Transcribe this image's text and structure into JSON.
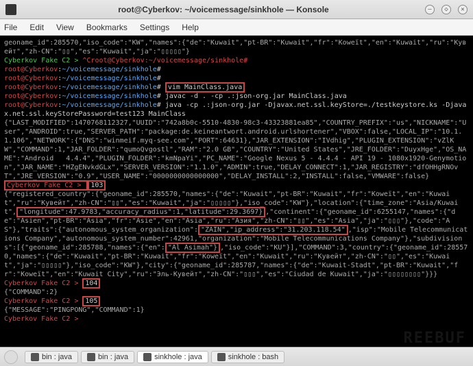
{
  "window": {
    "title": "root@Cyberkov: ~/voicemessage/sinkhole — Konsole",
    "minimize": "–",
    "maximize": "◇",
    "close": "✕"
  },
  "menu": {
    "file": "File",
    "edit": "Edit",
    "view": "View",
    "bookmarks": "Bookmarks",
    "settings": "Settings",
    "help": "Help"
  },
  "tabs": {
    "new": "",
    "t1": "bin : java",
    "t2": "bin : java",
    "t3": "sinkhole : java",
    "t4": "sinkhole : bash"
  },
  "prompt": {
    "user": "root@Cyberkov",
    "path": "~/voicemessage/sinkhole",
    "sep": ":",
    "hash": "#"
  },
  "cmd": {
    "blank": "",
    "vim": "vim MainClass.java",
    "javac": "javac -d . -cp .:json-org.jar MainClass.java",
    "java": "java -cp .:json-org.jar -Djavax.net.ssl.keyStore=./testkeystore.ks -Djavax.net.ssl.keyStorePassword=test123 MainClass"
  },
  "line1": "geoname_id\":285570,\"iso_code\":\"KW\",\"names\":{\"de\":\"Kuwait\",\"pt-BR\":\"Kuwait\",\"fr\":\"Koweït\",\"en\":\"Kuwait\",\"ru\":\"Кувейт\",\"zh-CN\":\"▯▯\",\"es\":\"Kuwait\",\"ja\":\"▯▯▯▯▯\"}",
  "fakec2": "Cyberkov Fake C2 > ",
  "fakec2_cmd": "^Croot@Cyberkov:~/voicemessage/sinkhole#",
  "out1": "{\"LAST_MODIFIED\":1470768112327,\"UUID\":\"742a8b0c-5510-4830-98c3-43323881ea85\",\"COUNTRY_PREFIX\":\"us\",\"NICKNAME\":\"User\",\"ANDROID\":true,\"SERVER_PATH\":\"package:de.keineantwort.android.urlshortener\",\"VBOX\":false,\"LOCAL_IP\":\"10.1.1.106\",\"NETWORK\":{\"DNS\":\"winmeif.myq-see.com\",\"PORT\":64631},\"JAR_EXTENSION\":\"IVdhig\",\"PLUGIN_EXTENSION\":\"vZlKW\",\"COMMAND\":1,\"JAR_FOLDER\":\"qumoQvgostl\",\"RAM\":\"2.0 GB\",\"COUNTRY\":\"United States\",\"JRE_FOLDER\":\"DuyxHge\",\"OS_NAME\":\"Android   4.4.4\",\"PLUGIN_FOLDER\":\"kmNpaYi\",\"PC_NAME\":\"Google Nexus 5 - 4.4.4 - API 19 - 1080x1920-Genymotion\",\"JAR_NAME\":\"HZgENvkdGLx\",\"SERVER_VERSION\":\"1.1.0\",\"ADMIN\":true,\"DELAY_CONNECT\":1,\"JAR_REGISTRY\":\"dfOHHgRNOvT\",\"JRE_VERSION\":\"0.9\",\"USER_NAME\":\"0000000000000000\",\"DELAY_INSTALL\":2,\"INSTALL\":false,\"VMWARE\":false}",
  "n103": "103",
  "out2a": "{\"registered_country\":{\"geoname_id\":285570,\"names\":{\"de\":\"Kuwait\",\"pt-BR\":\"Kuwait\",\"fr\":\"Koweït\",\"en\":\"Kuwait\",\"ru\":\"Кувейт\",\"zh-CN\":\"▯▯\",\"es\":\"Kuwait\",\"ja\":\"▯▯▯▯▯\"},\"iso_code\":\"KW\"},\"location\":{\"time_zone\":\"Asia/Kuwait\",",
  "loc_hl": "\"longitude\":47.9783,\"accuracy_radius\":1,\"latitude\":29.3697}",
  "out2b": ",\"continent\":{\"geoname_id\":6255147,\"names\":{\"de\":\"Asien\",\"pt-BR\":\"Ásia\",\"fr\":\"Asie\",\"en\":\"Asia\",\"ru\":\"Азия\",\"zh-CN\":\"▯▯\",\"es\":\"Asia\",\"ja\":\"▯▯▯\"},\"code\":\"AS\"},\"traits\":{\"autonomous_system_organization\":",
  "zain_hl": "\"ZAIN\",\"ip_address\":\"31.203.118.54\"",
  "out2c": ",\"isp\":\"Mobile Telecommunications Company\",\"autonomous_system_number\":42961,\"organization\":\"Mobile Telecommunications Company\"},\"subdivisions\":[{\"geoname_id\":285788,\"names\":{\"en\":",
  "asimah_hl": "\"Al Asimah\"}",
  "out2d": ",\"iso_code\":\"KU\"}],\"COMMAND\":3,\"country\":{\"geoname_id\":285570,\"names\":{\"de\":\"Kuwait\",\"pt-BR\":\"Kuwait\",\"fr\":\"Koweït\",\"en\":\"Kuwait\",\"ru\":\"Кувейт\",\"zh-CN\":\"▯▯\",\"es\":\"Kuwait\",\"ja\":\"▯▯▯▯▯\"},\"iso_code\":\"KW\"},\"city\":{\"geoname_id\":285787,\"names\":{\"de\":\"Kuwait-Stadt\",\"pt-BR\":\"Kuwait\",\"fr\":\"Koweït\",\"en\":\"Kuwait City\",\"ru\":\"Эль-Кувейт\",\"zh-CN\":\"▯▯▯\",\"es\":\"Ciudad de Kuwait\",\"ja\":\"▯▯▯▯▯▯▯▯\"}}}",
  "n104": "104",
  "out3": "{\"COMMAND\":2}",
  "n105": "105",
  "out4": "{\"MESSAGE\":\"PINGPONG\",\"COMMAND\":1}",
  "watermark": "REEBUF"
}
